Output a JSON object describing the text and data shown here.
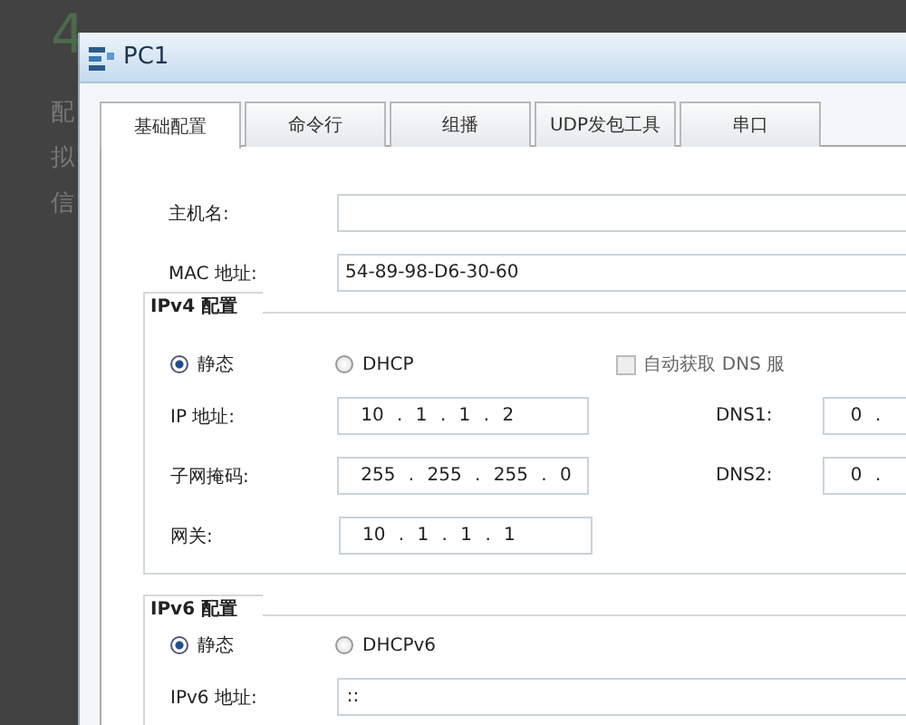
{
  "background_text": [
    {
      "kind": "heading",
      "text": "4"
    },
    {
      "kind": "text",
      "text": "配"
    },
    {
      "kind": "text",
      "text": "拟"
    },
    {
      "kind": "text",
      "text": "信"
    }
  ],
  "window": {
    "title": "PC1"
  },
  "tabs": [
    {
      "label": "基础配置",
      "selected": true
    },
    {
      "label": "命令行",
      "selected": false
    },
    {
      "label": "组播",
      "selected": false
    },
    {
      "label": "UDP发包工具",
      "selected": false
    },
    {
      "label": "串口",
      "selected": false
    }
  ],
  "hostname": {
    "label": "主机名:"
  },
  "mac": {
    "label": "MAC 地址:",
    "value": "54-89-98-D6-30-60"
  },
  "ipv4": {
    "title": "IPv4 配置",
    "modes": [
      {
        "label": "静态",
        "selected": true
      },
      {
        "label": "DHCP",
        "selected": false
      }
    ],
    "auto_dns": {
      "label": "自动获取 DNS 服",
      "checked": false
    },
    "rows": [
      {
        "label": "IP 地址:",
        "value": "10 . 1 . 1 . 2",
        "dns_label": "DNS1:",
        "dns_value": "0 ."
      },
      {
        "label": "子网掩码:",
        "value": "255 . 255 . 255 . 0",
        "dns_label": "DNS2:",
        "dns_value": "0 ."
      },
      {
        "label": "网关:",
        "value": "10 . 1 . 1 . 1"
      }
    ]
  },
  "ipv6": {
    "title": "IPv6 配置",
    "modes": [
      {
        "label": "静态",
        "selected": true
      },
      {
        "label": "DHCPv6",
        "selected": false
      }
    ],
    "rows": [
      {
        "label": "IPv6 地址:",
        "value": "::"
      }
    ]
  }
}
